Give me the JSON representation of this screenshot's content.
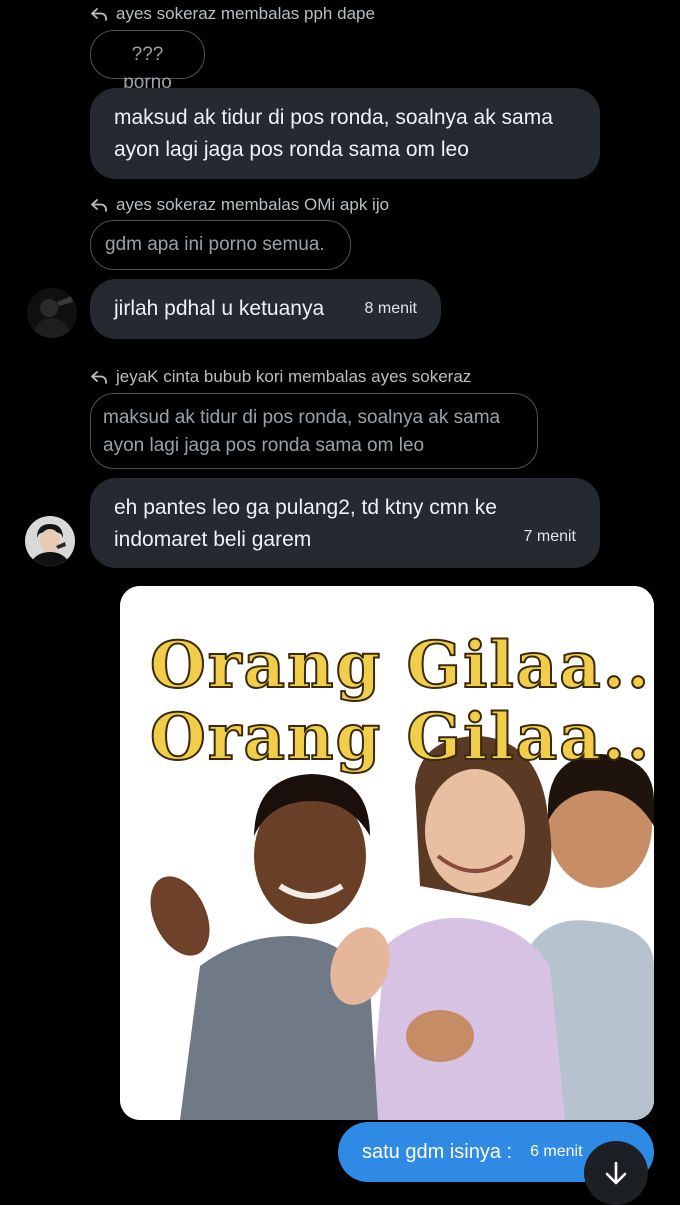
{
  "messages": [
    {
      "reply_header": "ayes sokeraz membalas pph dape",
      "quote": "??? porno",
      "text": "maksud ak tidur di pos ronda, soalnya ak sama ayon lagi jaga pos ronda sama om leo"
    },
    {
      "reply_header": "ayes sokeraz membalas OMi apk ijo",
      "quote": "gdm apa ini porno semua.",
      "text": "jirlah pdhal u ketuanya",
      "time": "8 menit"
    },
    {
      "reply_header": "jeyaK cinta bubub kori membalas ayes sokeraz",
      "quote": "maksud ak tidur di pos ronda, soalnya ak sama ayon lagi jaga pos ronda sama om leo",
      "text": "eh pantes leo ga pulang2, td ktny cmn ke indomaret beli garem",
      "time": "7 menit"
    }
  ],
  "meme": {
    "line1": "Orang Gilaa...",
    "line2": "Orang Gilaa..."
  },
  "own_message": {
    "text": "satu gdm isinya :",
    "time": "6 menit"
  },
  "icons": {
    "reply": "reply-arrow-icon",
    "scroll": "arrow-down-icon"
  },
  "colors": {
    "background": "#000000",
    "bubble": "#242a30",
    "own_bubble": "#2f8ae5",
    "meme_text": "#f1cd4c"
  }
}
